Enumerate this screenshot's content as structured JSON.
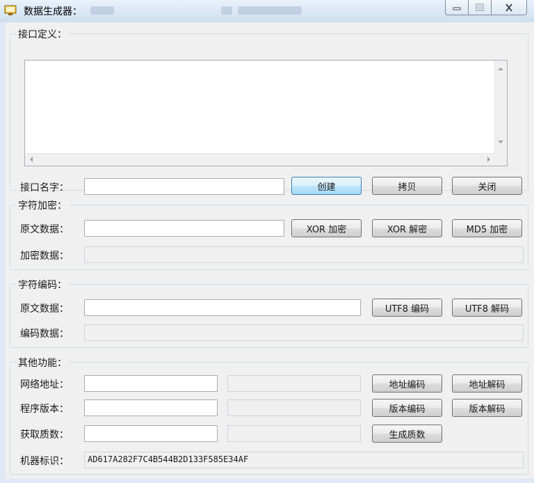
{
  "window": {
    "title": "数据生成器："
  },
  "interface_group": {
    "title": "接口定义：",
    "definition_text": "",
    "name_label": "接口名字：",
    "name_value": "",
    "create_label": "创建",
    "copy_label": "拷贝",
    "close_label": "关闭"
  },
  "encrypt_group": {
    "title": "字符加密：",
    "source_label": "原文数据：",
    "source_value": "",
    "result_label": "加密数据：",
    "result_value": "",
    "xor_encrypt_label": "XOR 加密",
    "xor_decrypt_label": "XOR 解密",
    "md5_encrypt_label": "MD5 加密"
  },
  "encode_group": {
    "title": "字符编码：",
    "source_label": "原文数据：",
    "source_value": "",
    "result_label": "编码数据：",
    "result_value": "",
    "utf8_encode_label": "UTF8 编码",
    "utf8_decode_label": "UTF8 解码"
  },
  "other_group": {
    "title": "其他功能：",
    "url_label": "网络地址：",
    "url_value": "",
    "url_result": "",
    "url_encode_label": "地址编码",
    "url_decode_label": "地址解码",
    "version_label": "程序版本：",
    "version_value": "",
    "version_result": "",
    "version_encode_label": "版本编码",
    "version_decode_label": "版本解码",
    "prime_label": "获取质数：",
    "prime_value": "",
    "prime_result": "",
    "prime_generate_label": "生成质数",
    "machine_label": "机器标识：",
    "machine_value": "AD617A282F7C4B544B2D133F585E34AF"
  },
  "icons": {
    "app": "window-app-icon",
    "minimize": "minimize-icon",
    "maximize": "maximize-icon",
    "close": "close-icon"
  },
  "colors": {
    "title_bar": "#dbe7f4",
    "client_bg": "#f0f0f0",
    "default_button": "#bee6fd"
  }
}
